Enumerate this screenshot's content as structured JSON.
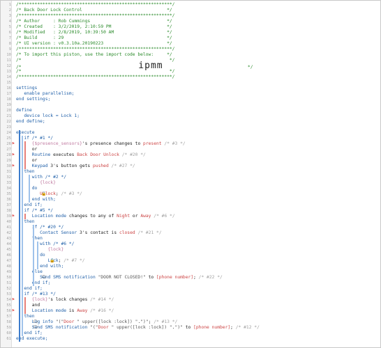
{
  "lines": [
    {
      "n": "1",
      "t": "/**********************************************************/",
      "cls": "c"
    },
    {
      "n": "2",
      "t": "/* Back Door Lock Control                                */",
      "cls": "c"
    },
    {
      "n": "3",
      "t": "/**********************************************************/",
      "cls": "c"
    },
    {
      "n": "4",
      "t": "/* Author     : Rob Cummings                             */",
      "cls": "c"
    },
    {
      "n": "5",
      "t": "/* Created    : 3/2/2019, 2:10:59 PM                     */",
      "cls": "c"
    },
    {
      "n": "6",
      "t": "/* Modified   : 2/8/2019, 10:39:50 AM                    */",
      "cls": "c"
    },
    {
      "n": "7",
      "t": "/* Build      : 29                                       */",
      "cls": "c"
    },
    {
      "n": "8",
      "t": "/* UI version : v0.3.10a.20190223                        */",
      "cls": "c"
    },
    {
      "n": "9",
      "t": "/**********************************************************/",
      "cls": "c"
    },
    {
      "n": "10",
      "t": "/* To import this piston, use the import code below:     */",
      "cls": "c"
    },
    {
      "n": "11",
      "t": "/*                                                        */",
      "cls": "c"
    },
    {
      "n": "12",
      "t": "/*                    ipmm                                */",
      "cls": "c"
    },
    {
      "n": "13",
      "t": "/*                                                        */",
      "cls": "c"
    },
    {
      "n": "14",
      "t": "/**********************************************************/",
      "cls": "c"
    },
    {
      "n": "15",
      "t": "",
      "cls": ""
    },
    {
      "n": "16",
      "t": "settings",
      "cls": "kw"
    },
    {
      "n": "17",
      "t": "   enable parallelism;",
      "cls": "kw"
    },
    {
      "n": "18",
      "t": "end settings;",
      "cls": "kw"
    },
    {
      "n": "19",
      "t": "",
      "cls": ""
    },
    {
      "n": "20",
      "t": "define",
      "cls": "kw"
    },
    {
      "n": "21",
      "t": "   device lock = Lock 1;",
      "cls": "kw"
    },
    {
      "n": "22",
      "t": "end define;",
      "cls": "kw"
    },
    {
      "n": "23",
      "t": "",
      "cls": ""
    },
    {
      "n": "24",
      "t": "execute",
      "cls": "kw"
    },
    {
      "n": "25",
      "t": "   if /* #1 */",
      "cls": "kw"
    },
    {
      "n": "26",
      "t": "      {$presence_sensors}'s presence changes to present /* #3 */",
      "cls": "mix"
    },
    {
      "n": "27",
      "t": "      or",
      "cls": ""
    },
    {
      "n": "28",
      "t": "      Routine executes Back Door Unlock /* #20 */",
      "cls": "mix"
    },
    {
      "n": "29",
      "t": "      or",
      "cls": ""
    },
    {
      "n": "30",
      "t": "      Keypad 3's button gets pushed /* #27 */",
      "cls": "mix"
    },
    {
      "n": "31",
      "t": "   then",
      "cls": "kw"
    },
    {
      "n": "32",
      "t": "      with /* #2 */",
      "cls": "kw"
    },
    {
      "n": "33",
      "t": "         {lock}",
      "cls": "var"
    },
    {
      "n": "34",
      "t": "      do",
      "cls": "kw"
    },
    {
      "n": "35",
      "t": "         Unlock; /* #3 */",
      "cls": "mix"
    },
    {
      "n": "36",
      "t": "      end with;",
      "cls": "kw"
    },
    {
      "n": "37",
      "t": "   end if;",
      "cls": "kw"
    },
    {
      "n": "38",
      "t": "   if /* #5 */",
      "cls": "kw"
    },
    {
      "n": "39",
      "t": "      Location mode changes to any of Night or Away /* #6 */",
      "cls": "mix"
    },
    {
      "n": "40",
      "t": "   then",
      "cls": "kw"
    },
    {
      "n": "41",
      "t": "      if /* #20 */",
      "cls": "kw"
    },
    {
      "n": "42",
      "t": "         Contact Sensor 3's contact is closed /* #21 */",
      "cls": "mix"
    },
    {
      "n": "43",
      "t": "      then",
      "cls": "kw"
    },
    {
      "n": "44",
      "t": "         with /* #6 */",
      "cls": "kw"
    },
    {
      "n": "45",
      "t": "            {lock}",
      "cls": "var"
    },
    {
      "n": "46",
      "t": "         do",
      "cls": "kw"
    },
    {
      "n": "47",
      "t": "            Lock; /* #7 */",
      "cls": "mix"
    },
    {
      "n": "48",
      "t": "         end with;",
      "cls": "kw"
    },
    {
      "n": "49",
      "t": "      else",
      "cls": "kw"
    },
    {
      "n": "50",
      "t": "         Send SMS notification \"DOOR NOT CLOSED!\" to [phone number]; /* #22 */",
      "cls": "mix"
    },
    {
      "n": "51",
      "t": "      end if;",
      "cls": "kw"
    },
    {
      "n": "52",
      "t": "   end if;",
      "cls": "kw"
    },
    {
      "n": "53",
      "t": "   if /* #13 */",
      "cls": "kw"
    },
    {
      "n": "54",
      "t": "      {lock}'s lock changes /* #14 */",
      "cls": "mix"
    },
    {
      "n": "55",
      "t": "      and",
      "cls": ""
    },
    {
      "n": "56",
      "t": "      Location mode is Away /* #16 */",
      "cls": "mix"
    },
    {
      "n": "57",
      "t": "   then",
      "cls": "kw"
    },
    {
      "n": "58",
      "t": "      Log info \"(\"Door \" upper([lock :lock]) \".\")\"; /* #13 */",
      "cls": "mix"
    },
    {
      "n": "59",
      "t": "      Send SMS notification \"(\"Door \" upper([lock :lock]) \".\")\" to [phone number]; /* #12 */",
      "cls": "mix"
    },
    {
      "n": "60",
      "t": "   end if;",
      "cls": "kw"
    },
    {
      "n": "61",
      "t": "end execute;",
      "cls": "kw"
    }
  ],
  "colors": {
    "comment": "#2a8a2a",
    "keyword": "#1f5fa8",
    "value": "#cc4444",
    "variable": "#c07aa0",
    "bar_blue": "#3c7ccc",
    "bar_red": "#e77f78"
  },
  "icons": [
    "lock-icon",
    "message-icon"
  ]
}
